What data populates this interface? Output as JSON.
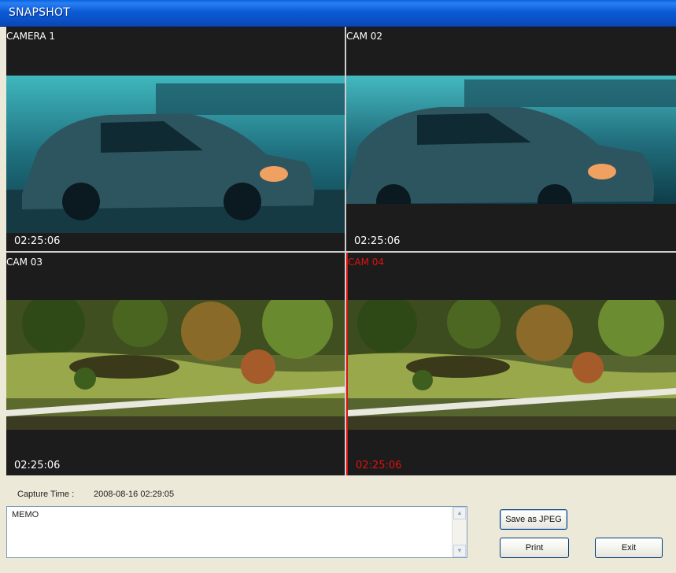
{
  "window": {
    "title": "SNAPSHOT"
  },
  "cameras": [
    {
      "label": "CAMERA 1",
      "time": "02:25:06",
      "scene": "car-harbor",
      "active": false
    },
    {
      "label": "CAM 02",
      "time": "02:25:06",
      "scene": "car-harbor",
      "active": false
    },
    {
      "label": "CAM 03",
      "time": "02:25:06",
      "scene": "garden",
      "active": false
    },
    {
      "label": "CAM 04",
      "time": "02:25:06",
      "scene": "garden",
      "active": true
    }
  ],
  "capture": {
    "label": "Capture Time :",
    "value": "2008-08-16  02:29:05"
  },
  "memo": {
    "value": "MEMO"
  },
  "buttons": {
    "save": "Save as JPEG",
    "print": "Print",
    "exit": "Exit"
  },
  "colors": {
    "active_camera": "#e01010",
    "titlebar": "#0b5bd6"
  }
}
